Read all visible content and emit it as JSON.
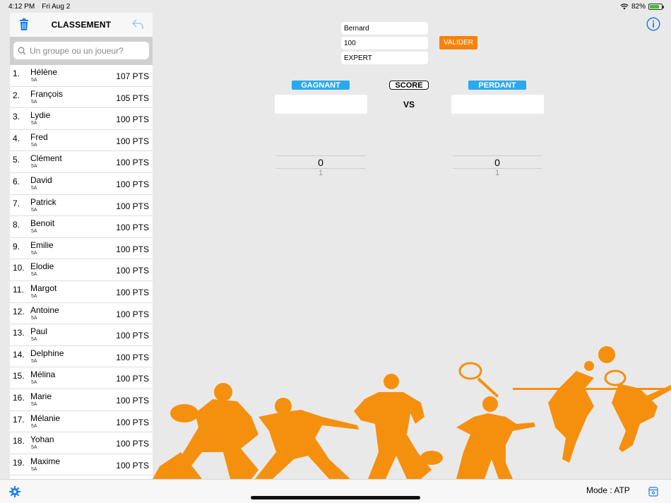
{
  "status": {
    "time": "4:12 PM",
    "date": "Fri Aug 2",
    "battery": "82%",
    "battery_level": 0.82
  },
  "sidebar": {
    "title": "CLASSEMENT",
    "search_placeholder": "Un groupe ou un joueur?",
    "rows": [
      {
        "num": "1.",
        "name": "Hélène",
        "group": "5A",
        "pts": "107 PTS"
      },
      {
        "num": "2.",
        "name": "François",
        "group": "5A",
        "pts": "105 PTS"
      },
      {
        "num": "3.",
        "name": "Lydie",
        "group": "5A",
        "pts": "100 PTS"
      },
      {
        "num": "4.",
        "name": "Fred",
        "group": "5A",
        "pts": "100 PTS"
      },
      {
        "num": "5.",
        "name": "Clément",
        "group": "5A",
        "pts": "100 PTS"
      },
      {
        "num": "6.",
        "name": "David",
        "group": "5A",
        "pts": "100 PTS"
      },
      {
        "num": "7.",
        "name": "Patrick",
        "group": "5A",
        "pts": "100 PTS"
      },
      {
        "num": "8.",
        "name": "Benoit",
        "group": "5A",
        "pts": "100 PTS"
      },
      {
        "num": "9.",
        "name": "Emilie",
        "group": "5A",
        "pts": "100 PTS"
      },
      {
        "num": "10.",
        "name": "Elodie",
        "group": "5A",
        "pts": "100 PTS"
      },
      {
        "num": "11.",
        "name": "Margot",
        "group": "5A",
        "pts": "100 PTS"
      },
      {
        "num": "12.",
        "name": "Antoine",
        "group": "5A",
        "pts": "100 PTS"
      },
      {
        "num": "13.",
        "name": "Paul",
        "group": "5A",
        "pts": "100 PTS"
      },
      {
        "num": "14.",
        "name": "Delphine",
        "group": "5A",
        "pts": "100 PTS"
      },
      {
        "num": "15.",
        "name": "Mélina",
        "group": "5A",
        "pts": "100 PTS"
      },
      {
        "num": "16.",
        "name": "Marie",
        "group": "5A",
        "pts": "100 PTS"
      },
      {
        "num": "17.",
        "name": "Mélanie",
        "group": "5A",
        "pts": "100 PTS"
      },
      {
        "num": "18.",
        "name": "Yohan",
        "group": "5A",
        "pts": "100 PTS"
      },
      {
        "num": "19.",
        "name": "Maxime",
        "group": "5A",
        "pts": "100 PTS"
      }
    ]
  },
  "form": {
    "name_value": "Bernard",
    "points_value": "100",
    "level_value": "EXPERT",
    "validate_label": "VALIDER"
  },
  "match": {
    "winner_label": "GAGNANT",
    "score_label": "SCORE",
    "loser_label": "PERDANT",
    "vs_label": "VS",
    "winner_score": "0",
    "winner_score_next": "1",
    "loser_score": "0",
    "loser_score_next": "1"
  },
  "footer": {
    "mode": "Mode : ATP"
  },
  "colors": {
    "accent_orange": "#f5820c",
    "accent_blue": "#2aa9f0",
    "ios_blue": "#1a7cf0"
  }
}
